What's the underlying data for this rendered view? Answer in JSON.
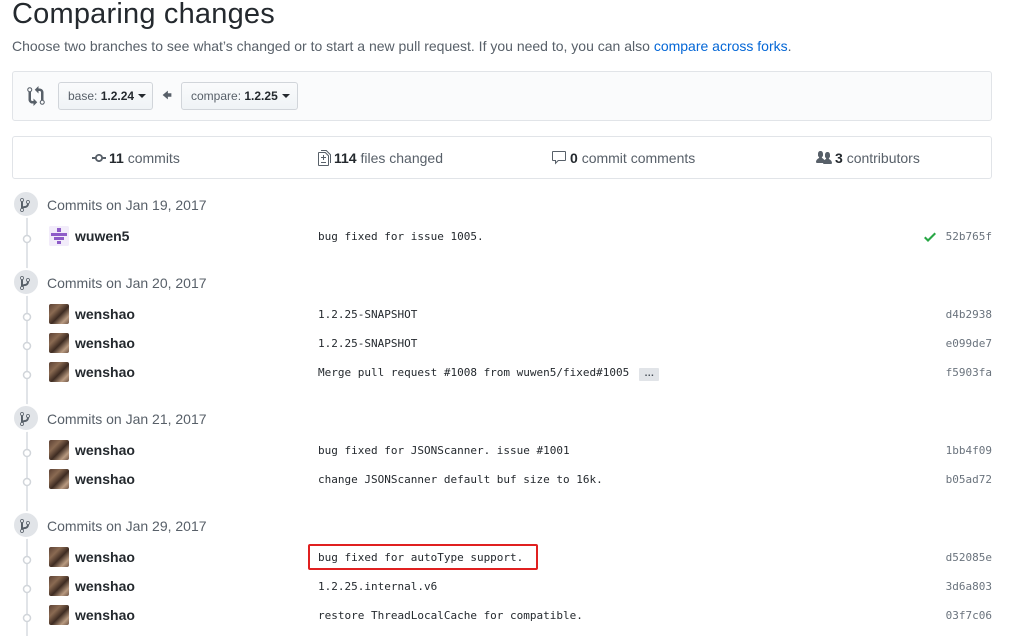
{
  "header": {
    "title": "Comparing changes",
    "subtitle_text": "Choose two branches to see what’s changed or to start a new pull request. If you need to, you can also",
    "subtitle_link": "compare across forks",
    "subtitle_end": "."
  },
  "range": {
    "base_prefix": "base:",
    "base_value": "1.2.24",
    "compare_prefix": "compare:",
    "compare_value": "1.2.25"
  },
  "stats": {
    "commits_count": "11",
    "commits_label": "commits",
    "files_count": "114",
    "files_label": "files changed",
    "comments_count": "0",
    "comments_label": "commit comments",
    "contributors_count": "3",
    "contributors_label": "contributors"
  },
  "groups": [
    {
      "label": "Commits on Jan 19, 2017",
      "commits": [
        {
          "author": "wuwen5",
          "message": "bug fixed for issue 1005.",
          "sha": "52b765f",
          "status": "success",
          "avatar": "identicon"
        }
      ]
    },
    {
      "label": "Commits on Jan 20, 2017",
      "commits": [
        {
          "author": "wenshao",
          "message": "1.2.25-SNAPSHOT",
          "sha": "d4b2938",
          "avatar": "photo"
        },
        {
          "author": "wenshao",
          "message": "1.2.25-SNAPSHOT",
          "sha": "e099de7",
          "avatar": "photo"
        },
        {
          "author": "wenshao",
          "message": "Merge pull request #1008 from wuwen5/fixed#1005",
          "sha": "f5903fa",
          "avatar": "photo",
          "expand": "…"
        }
      ]
    },
    {
      "label": "Commits on Jan 21, 2017",
      "commits": [
        {
          "author": "wenshao",
          "message": "bug fixed for JSONScanner. issue #1001",
          "sha": "1bb4f09",
          "avatar": "photo"
        },
        {
          "author": "wenshao",
          "message": "change JSONScanner default buf size to 16k.",
          "sha": "b05ad72",
          "avatar": "photo"
        }
      ]
    },
    {
      "label": "Commits on Jan 29, 2017",
      "commits": [
        {
          "author": "wenshao",
          "message": "bug fixed for autoType support.",
          "sha": "d52085e",
          "avatar": "photo",
          "highlighted": true
        },
        {
          "author": "wenshao",
          "message": "1.2.25.internal.v6",
          "sha": "3d6a803",
          "avatar": "photo"
        },
        {
          "author": "wenshao",
          "message": "restore ThreadLocalCache for compatible.",
          "sha": "03f7c06",
          "avatar": "photo"
        }
      ]
    }
  ],
  "colors": {
    "link": "#0366d6",
    "success": "#28a745",
    "highlight": "#e02020"
  }
}
